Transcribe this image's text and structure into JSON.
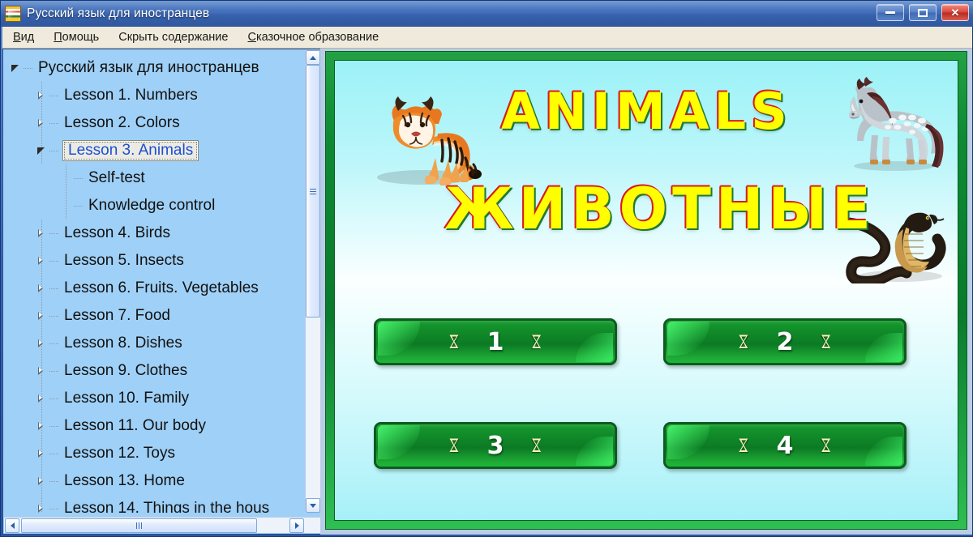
{
  "window": {
    "title": "Русский язык для иностранцев",
    "icon": "book-icon",
    "controls": {
      "minimize": "minimize-icon",
      "maximize": "maximize-icon",
      "close": "✕"
    }
  },
  "menubar": {
    "items": [
      {
        "pre": "",
        "accel": "В",
        "post": "ид"
      },
      {
        "pre": "",
        "accel": "П",
        "post": "омощь"
      },
      {
        "pre": "Скрыть со",
        "accel": "д",
        "post": "ержание"
      },
      {
        "pre": "",
        "accel": "С",
        "post": "казочное образование"
      }
    ]
  },
  "tree": {
    "root": "Русский язык для иностранцев",
    "nodes": [
      {
        "label": "Lesson 1. Numbers",
        "level": 1,
        "state": "collapsed",
        "selected": false
      },
      {
        "label": "Lesson 2. Colors",
        "level": 1,
        "state": "collapsed",
        "selected": false
      },
      {
        "label": "Lesson 3. Animals",
        "level": 1,
        "state": "expanded",
        "selected": true
      },
      {
        "label": "Self-test",
        "level": 2,
        "state": "leaf",
        "selected": false
      },
      {
        "label": "Knowledge control",
        "level": 2,
        "state": "leaf",
        "selected": false
      },
      {
        "label": "Lesson 4. Birds",
        "level": 1,
        "state": "collapsed",
        "selected": false
      },
      {
        "label": "Lesson 5. Insects",
        "level": 1,
        "state": "collapsed",
        "selected": false
      },
      {
        "label": "Lesson 6. Fruits. Vegetables",
        "level": 1,
        "state": "collapsed",
        "selected": false
      },
      {
        "label": "Lesson 7. Food",
        "level": 1,
        "state": "collapsed",
        "selected": false
      },
      {
        "label": "Lesson 8. Dishes",
        "level": 1,
        "state": "collapsed",
        "selected": false
      },
      {
        "label": "Lesson 9. Clothes",
        "level": 1,
        "state": "collapsed",
        "selected": false
      },
      {
        "label": "Lesson 10. Family",
        "level": 1,
        "state": "collapsed",
        "selected": false
      },
      {
        "label": "Lesson 11. Our body",
        "level": 1,
        "state": "collapsed",
        "selected": false
      },
      {
        "label": "Lesson 12. Toys",
        "level": 1,
        "state": "collapsed",
        "selected": false
      },
      {
        "label": "Lesson 13. Home",
        "level": 1,
        "state": "collapsed",
        "selected": false
      },
      {
        "label": "Lesson 14. Things in the hous",
        "level": 1,
        "state": "collapsed",
        "selected": false
      }
    ]
  },
  "slide": {
    "title_en": "ANIMALS",
    "title_ru": "ЖИВОТНЫЕ",
    "art": [
      "tiger-illustration",
      "horse-illustration",
      "snake-illustration"
    ],
    "buttons": [
      {
        "number": "1",
        "ornament_left": "ೱ",
        "ornament_right": "ೱ"
      },
      {
        "number": "2",
        "ornament_left": "ೱ",
        "ornament_right": "ೱ"
      },
      {
        "number": "3",
        "ornament_left": "ೱ",
        "ornament_right": "ೱ"
      },
      {
        "number": "4",
        "ornament_left": "ೱ",
        "ornament_right": "ೱ"
      }
    ]
  },
  "colors": {
    "titlebar": "#3761ad",
    "menubar": "#efeadb",
    "tree_bg": "#9fd0f7",
    "selection_text": "#1d4fd1",
    "slide_border": "#0e8a33",
    "slide_bg": "#b9f6fa",
    "title_fill": "#ffff00",
    "title_outline_left": "#d81c1c",
    "title_outline_right": "#1f7a35",
    "button_green": "#13912b"
  }
}
